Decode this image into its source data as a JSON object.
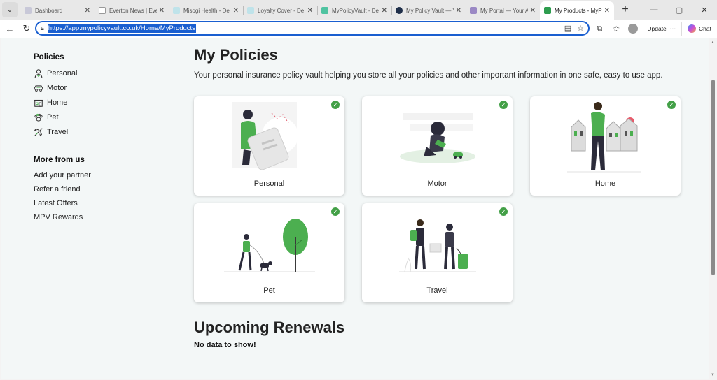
{
  "browser": {
    "tabs": [
      {
        "title": "Dashboard",
        "color": "#c8c8d8"
      },
      {
        "title": "Everton News | Eve",
        "color": "#ffffff"
      },
      {
        "title": "Misogi Health - De",
        "color": "#bfe3ea"
      },
      {
        "title": "Loyalty Cover - De",
        "color": "#bfe3ea"
      },
      {
        "title": "MyPolicyVault - De",
        "color": "#4fc3a1"
      },
      {
        "title": "My Policy Vault — Y",
        "color": "#1f2f4a"
      },
      {
        "title": "My Portal — Your A",
        "color": "#9a88c4"
      },
      {
        "title": "My Products - MyP",
        "color": "#2e9d4f"
      }
    ],
    "url": "https://app.mypolicyvault.co.uk/Home/MyProducts",
    "update_label": "Update",
    "chat_label": "Chat"
  },
  "sidebar": {
    "policies_heading": "Policies",
    "policies": [
      {
        "label": "Personal",
        "icon": "person-icon"
      },
      {
        "label": "Motor",
        "icon": "car-icon"
      },
      {
        "label": "Home",
        "icon": "house-icon"
      },
      {
        "label": "Pet",
        "icon": "paw-icon"
      },
      {
        "label": "Travel",
        "icon": "plane-icon"
      }
    ],
    "more_heading": "More from us",
    "links": [
      "Add your partner",
      "Refer a friend",
      "Latest Offers",
      "MPV Rewards"
    ]
  },
  "main": {
    "title": "My Policies",
    "subtitle": "Your personal insurance policy vault helping you store all your policies and other important information in one safe, easy to use app.",
    "cards": [
      {
        "label": "Personal",
        "checked": true
      },
      {
        "label": "Motor",
        "checked": true
      },
      {
        "label": "Home",
        "checked": true
      },
      {
        "label": "Pet",
        "checked": true
      },
      {
        "label": "Travel",
        "checked": true
      }
    ],
    "renewals_title": "Upcoming Renewals",
    "renewals_empty": "No data to show!"
  },
  "colors": {
    "accent": "#1a5fd0",
    "check": "#43a047",
    "illustration_green": "#4caf50"
  }
}
